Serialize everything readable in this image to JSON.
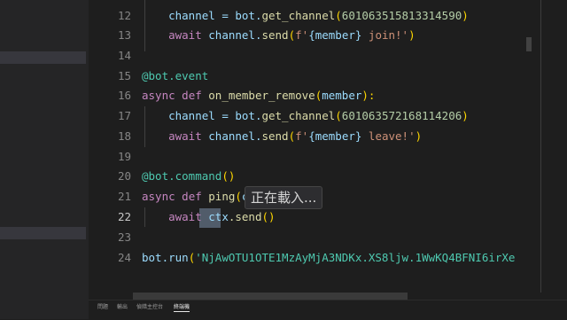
{
  "gutter": {
    "line_numbers": [
      "12",
      "13",
      "14",
      "15",
      "16",
      "17",
      "18",
      "19",
      "20",
      "21",
      "22",
      "23",
      "24"
    ]
  },
  "code": {
    "l12": {
      "indent": "    ",
      "a": "channel = bot.",
      "b": "get_channel",
      "c": "(",
      "d": "601063515813314590",
      "e": ")"
    },
    "l13": {
      "indent": "    ",
      "kw": "await",
      "a": " channel.",
      "b": "send",
      "c": "(",
      "d": "f'",
      "e": "{member}",
      "f": " join!'",
      "g": ")"
    },
    "l15": {
      "a": "@bot.event"
    },
    "l16": {
      "kw": "async",
      "kw2": " def",
      "sp": " ",
      "fn": "on_member_remove",
      "c": "(",
      "p": "member",
      "e": "):"
    },
    "l17": {
      "indent": "    ",
      "a": "channel = bot.",
      "b": "get_channel",
      "c": "(",
      "d": "601063572168114206",
      "e": ")"
    },
    "l18": {
      "indent": "    ",
      "kw": "await",
      "a": " channel.",
      "b": "send",
      "c": "(",
      "d": "f'",
      "e": "{member}",
      "f": " leave!'",
      "g": ")"
    },
    "l20": {
      "a": "@bot.command",
      "b": "()"
    },
    "l21": {
      "kw": "async",
      "kw2": " def",
      "sp": " ",
      "fn": "ping",
      "c": "(",
      "p": "c"
    },
    "l22": {
      "indent": "    ",
      "kw": "await",
      "sp": " ",
      "a": "ctx",
      "b": ".send",
      "c": "()"
    },
    "l24": {
      "a": "bot.run",
      "b": "(",
      "c": "'NjAwOTU1OTE1MzAyMjA3NDKx.XS8ljw.1WwKQ4BFNI6irXe"
    }
  },
  "tooltip": {
    "text": "正在載入..."
  },
  "panel": {
    "tabs": [
      "問題",
      "輸出",
      "偵錯主控台",
      "終端機"
    ],
    "active_tab": "終端機"
  },
  "colors": {
    "editor_bg": "#1e1e1e",
    "keyword": "#c586c0",
    "function": "#dcdcaa",
    "number": "#b5cea8",
    "string": "#ce9178",
    "decorator": "#4ec9b0"
  }
}
